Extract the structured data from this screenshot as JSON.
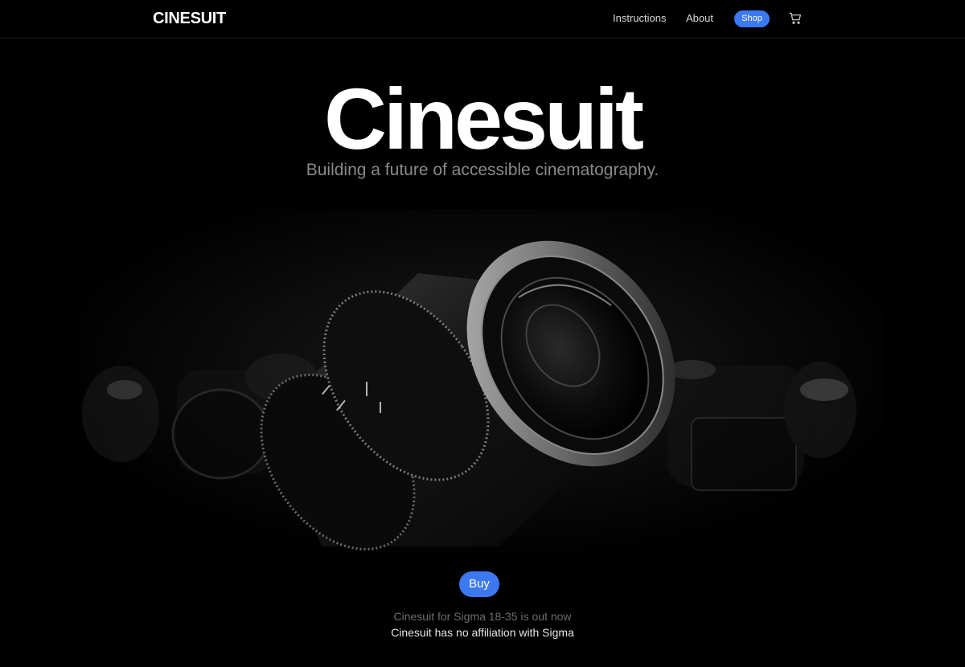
{
  "nav": {
    "logo": "CINESUIT",
    "links": [
      {
        "label": "Instructions"
      },
      {
        "label": "About"
      }
    ],
    "shop_label": "Shop",
    "cart_icon": "cart-icon",
    "accent": "#3c78f0"
  },
  "hero": {
    "title": "Cinesuit",
    "subtitle": "Building a future of accessible cinematography.",
    "image": "cinema-lenses-photo"
  },
  "cta": {
    "buy_label": "Buy",
    "note_1": "Cinesuit for Sigma 18-35 is out now",
    "note_2": "Cinesuit has no affiliation with Sigma"
  }
}
